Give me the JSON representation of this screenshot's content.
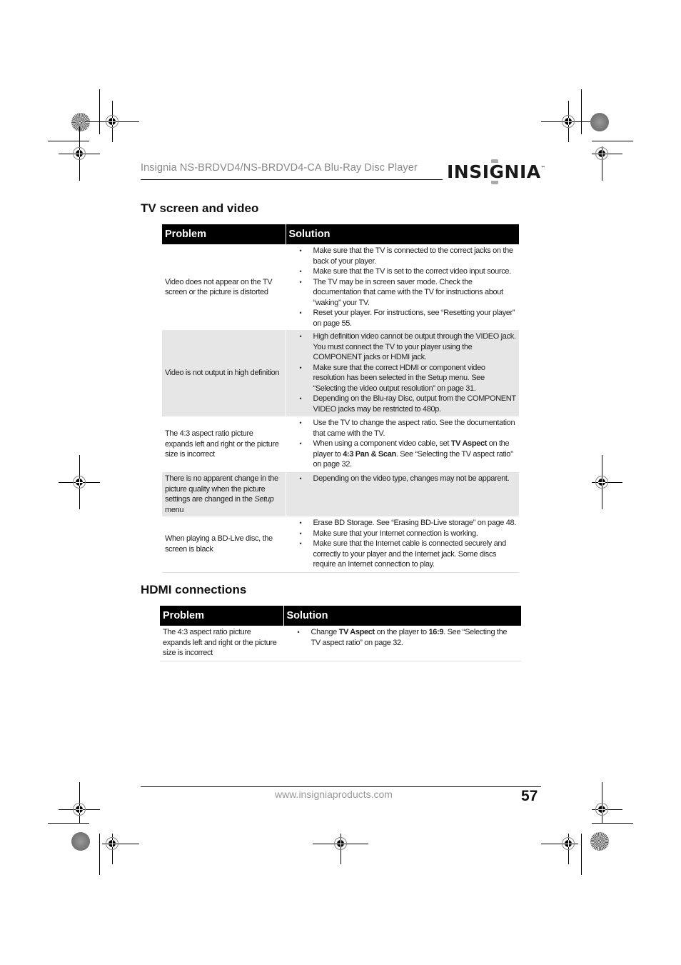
{
  "header": {
    "doc_title": "Insignia NS-BRDVD4/NS-BRDVD4-CA Blu-Ray Disc Player",
    "logo_text": "INSIGNIA",
    "logo_tm": "™"
  },
  "sections": [
    {
      "title": "TV screen and video",
      "columns": [
        "Problem",
        "Solution"
      ],
      "rows": [
        {
          "problem": "Video does not appear on the TV screen or the picture is distorted",
          "solutions": [
            "Make sure that the TV is connected to the correct jacks on the back of your player.",
            "Make sure that the TV is set to the correct video input source.",
            "The TV may be in screen saver mode. Check the documentation that came with the TV for instructions about “waking” your TV.",
            "Reset your player. For instructions, see “Resetting your player” on page 55."
          ]
        },
        {
          "problem": "Video is not output in high definition",
          "solutions": [
            "High definition video cannot be output through the VIDEO jack. You must connect the TV to your player using the COMPONENT jacks or HDMI jack.",
            "Make sure that the correct HDMI or component video resolution has been selected in the Setup menu. See “Selecting the video output resolution” on page 31.",
            "Depending on the Blu-ray Disc, output from the COMPONENT VIDEO jacks may be restricted to 480p."
          ]
        },
        {
          "problem": "The 4:3 aspect ratio picture expands left and right or the picture size is incorrect",
          "solutions": [
            "Use the TV to change the aspect ratio. See the documentation that came with the TV.",
            {
              "pre": "When using a component video cable, set ",
              "bold1": "TV Aspect",
              "mid": " on the player to ",
              "bold2": "4:3 Pan & Scan",
              "post": ". See “Selecting the TV aspect ratio” on page 32."
            }
          ]
        },
        {
          "problem_pre": "There is no apparent change in the picture quality when the picture settings are changed in the ",
          "problem_italic": "Setup",
          "problem_post": " menu",
          "solutions": [
            "Depending on the video type, changes may not be apparent."
          ]
        },
        {
          "problem": "When playing a BD-Live disc, the screen is black",
          "solutions": [
            "Erase BD Storage. See “Erasing BD-Live storage” on page 48.",
            "Make sure that your Internet connection is working.",
            "Make sure that the Internet cable is connected securely and correctly to your player and the Internet jack. Some discs require an Internet connection to play."
          ]
        }
      ]
    },
    {
      "title": "HDMI connections",
      "columns": [
        "Problem",
        "Solution"
      ],
      "rows": [
        {
          "problem": "The 4:3 aspect ratio picture expands left and right or the picture size is incorrect",
          "solutions": [
            {
              "pre": "Change ",
              "bold1": "TV Aspect",
              "mid": " on the player to ",
              "bold2": "16:9",
              "post": ". See “Selecting the TV aspect ratio” on page 32."
            }
          ]
        }
      ]
    }
  ],
  "footer": {
    "url": "www.insigniaproducts.com",
    "page_number": "57"
  }
}
